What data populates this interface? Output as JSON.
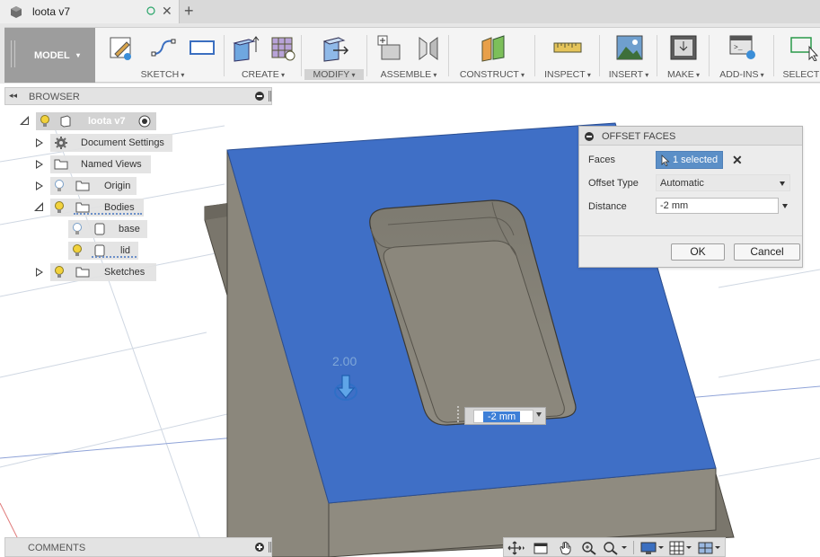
{
  "tab": {
    "title": "loota v7",
    "doc_icon": "cube-icon",
    "sync_icon": "sync-circle-icon",
    "close_icon": "close-icon",
    "new_tab_icon": "plus-icon"
  },
  "toolbar": {
    "workspace": "MODEL",
    "groups": [
      {
        "label": "SKETCH"
      },
      {
        "label": "CREATE"
      },
      {
        "label": "MODIFY",
        "active": true
      },
      {
        "label": "ASSEMBLE"
      },
      {
        "label": "CONSTRUCT"
      },
      {
        "label": "INSPECT"
      },
      {
        "label": "INSERT"
      },
      {
        "label": "MAKE"
      },
      {
        "label": "ADD-INS"
      },
      {
        "label": "SELECT"
      }
    ]
  },
  "browser": {
    "title": "BROWSER",
    "items": [
      {
        "label": "loota v7",
        "icon": "component-icon"
      },
      {
        "label": "Document Settings",
        "icon": "gear-icon"
      },
      {
        "label": "Named Views",
        "icon": "folder-icon"
      },
      {
        "label": "Origin",
        "icon": "folder-icon"
      },
      {
        "label": "Bodies",
        "icon": "folder-icon"
      },
      {
        "label": "base",
        "icon": "body-icon"
      },
      {
        "label": "lid",
        "icon": "body-icon"
      },
      {
        "label": "Sketches",
        "icon": "folder-icon"
      }
    ]
  },
  "dialog": {
    "title": "OFFSET FACES",
    "faces_label": "Faces",
    "faces_value": "1 selected",
    "offset_type_label": "Offset Type",
    "offset_type_value": "Automatic",
    "distance_label": "Distance",
    "distance_value": "-2 mm",
    "ok_label": "OK",
    "cancel_label": "Cancel"
  },
  "viewport": {
    "dimension_label": "2.00",
    "inline_input_value": "-2 mm",
    "face_color": "#3f6fc6",
    "body_color": "#8b877c"
  },
  "comments": {
    "title": "COMMENTS"
  }
}
